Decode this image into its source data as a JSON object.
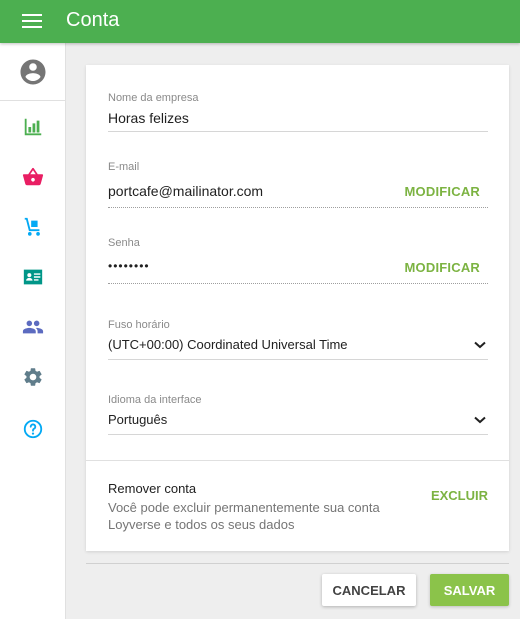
{
  "header": {
    "title": "Conta"
  },
  "sidebar": {
    "items": [
      {
        "icon": "account-circle-icon",
        "color": "#757575"
      },
      {
        "icon": "bar-chart-icon",
        "color": "#4caf50"
      },
      {
        "icon": "basket-icon",
        "color": "#e91e63"
      },
      {
        "icon": "hand-truck-icon",
        "color": "#03a9f4"
      },
      {
        "icon": "id-card-icon",
        "color": "#009688"
      },
      {
        "icon": "people-icon",
        "color": "#5c6bc0"
      },
      {
        "icon": "gear-icon",
        "color": "#607d8b"
      },
      {
        "icon": "help-icon",
        "color": "#03a9f4"
      }
    ]
  },
  "form": {
    "company": {
      "label": "Nome da empresa",
      "value": "Horas felizes"
    },
    "email": {
      "label": "E-mail",
      "value": "portcafe@mailinator.com",
      "action": "MODIFICAR"
    },
    "password": {
      "label": "Senha",
      "value": "••••••••",
      "action": "MODIFICAR"
    },
    "timezone": {
      "label": "Fuso horário",
      "value": "(UTC+00:00) Coordinated Universal Time"
    },
    "language": {
      "label": "Idioma da interface",
      "value": "Português"
    }
  },
  "remove": {
    "title": "Remover conta",
    "description": "Você pode excluir permanentemente sua conta Loyverse e todos os seus dados",
    "action": "EXCLUIR"
  },
  "footer": {
    "cancel_label": "CANCELAR",
    "save_label": "SALVAR"
  },
  "colors": {
    "primary": "#4caf50",
    "accent": "#7cb342",
    "save_button": "#8bc34a"
  }
}
